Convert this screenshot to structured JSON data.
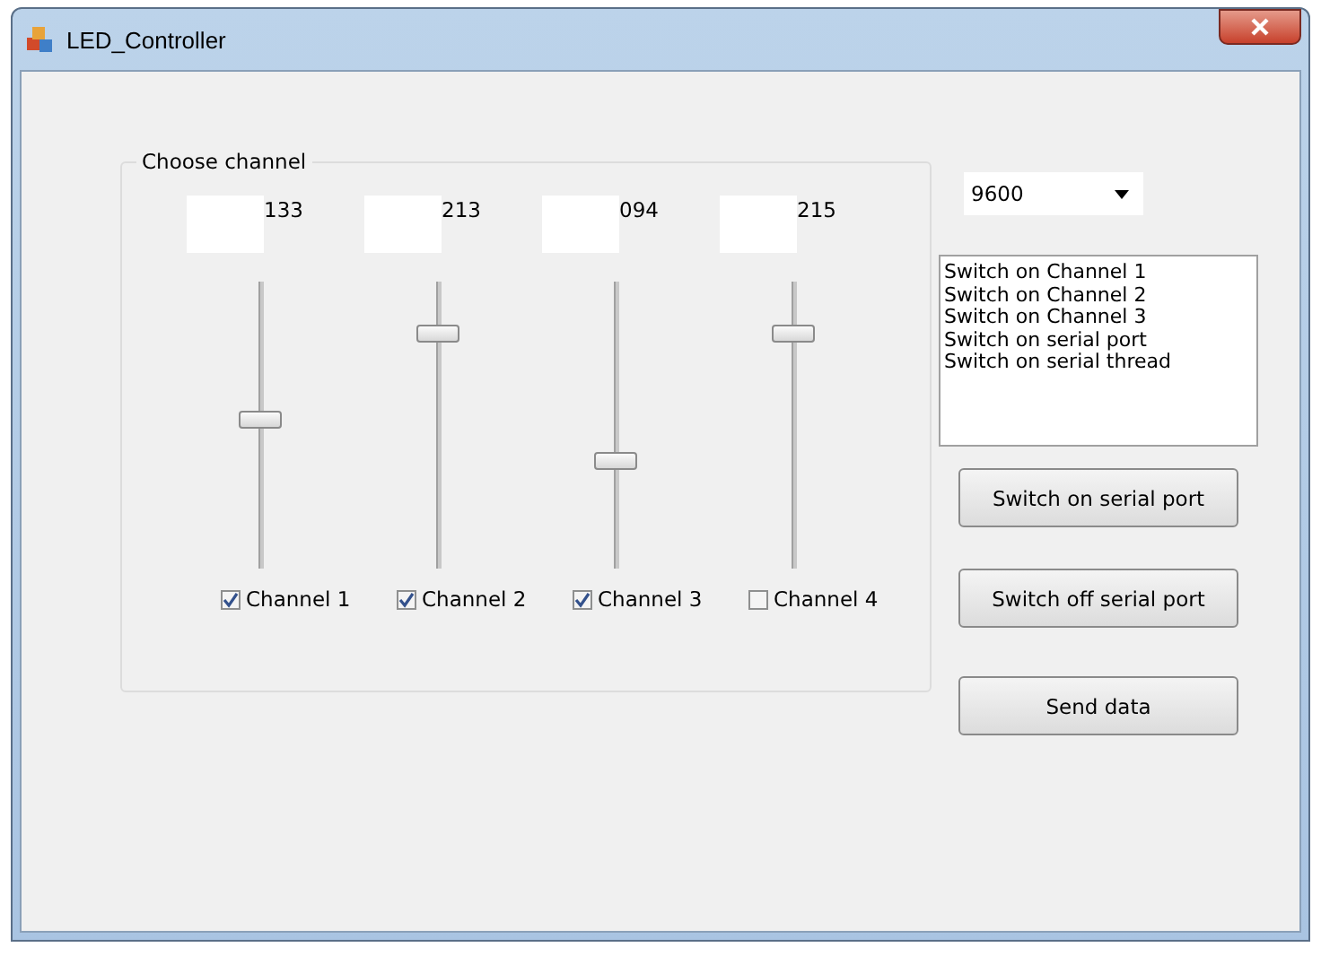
{
  "window": {
    "title": "LED_Controller"
  },
  "group": {
    "title": "Choose channel"
  },
  "channels": [
    {
      "reading": "133",
      "level": 0.52,
      "label": "Channel 1",
      "checked": true
    },
    {
      "reading": "213",
      "level": 0.84,
      "label": "Channel 2",
      "checked": true
    },
    {
      "reading": "094",
      "level": 0.37,
      "label": "Channel 3",
      "checked": true
    },
    {
      "reading": "215",
      "level": 0.84,
      "label": "Channel 4",
      "checked": false
    }
  ],
  "baud_rate": {
    "value": "9600"
  },
  "log": [
    "Switch on Channel 1",
    "Switch on Channel 2",
    "Switch on Channel 3",
    "Switch on serial port",
    "Switch on serial thread"
  ],
  "buttons": [
    "Switch on serial port",
    "Switch off serial port",
    "Send data"
  ]
}
